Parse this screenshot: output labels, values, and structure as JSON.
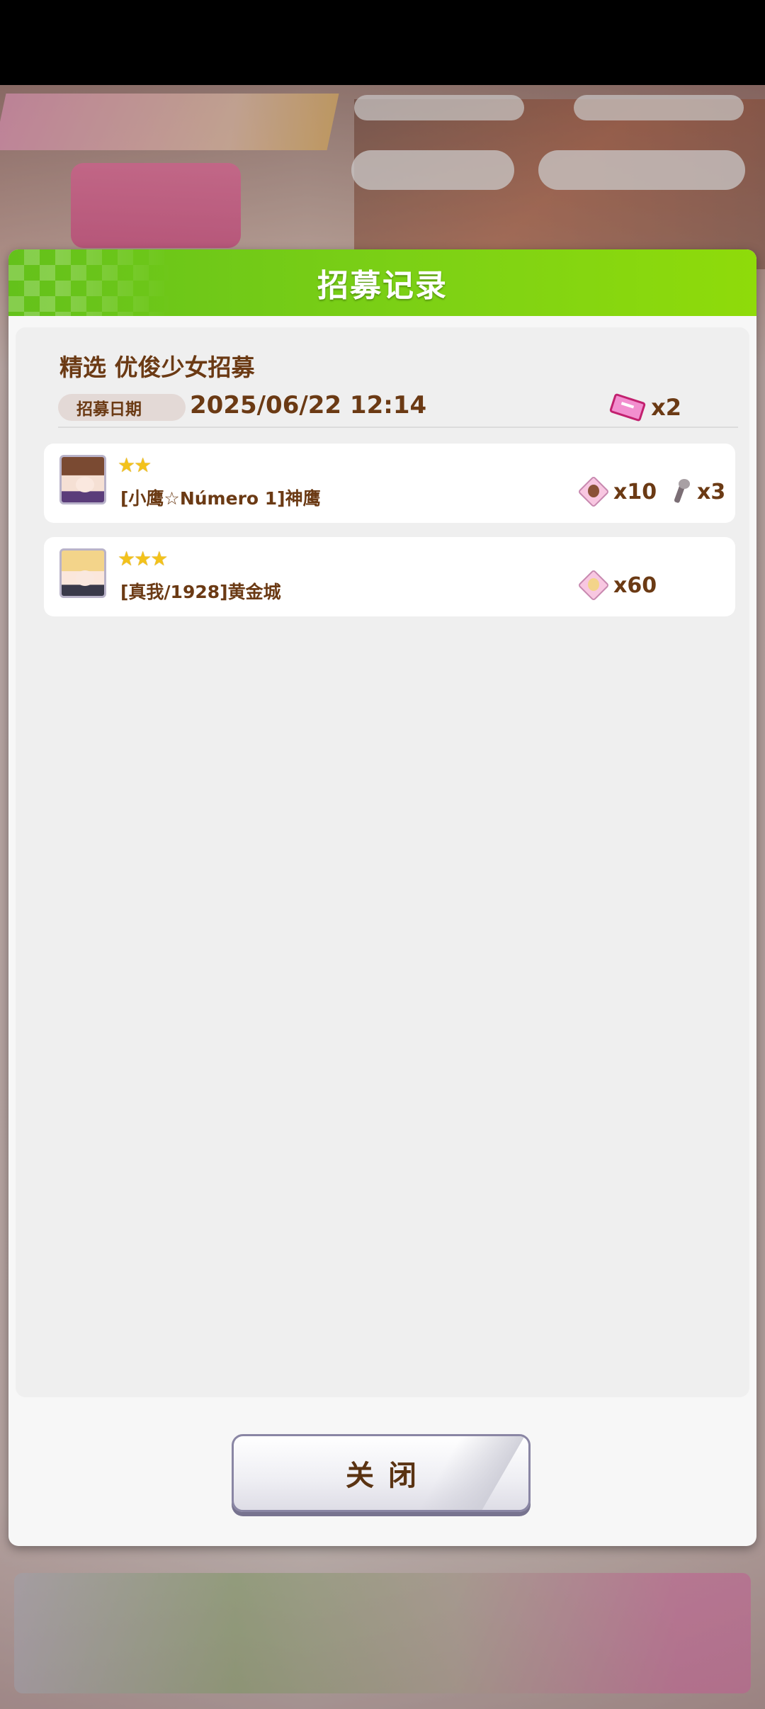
{
  "dialog": {
    "title": "招募记录",
    "banner_name": "精选  优俊少女招募",
    "date_label": "招募日期",
    "date_value": "2025/06/22  12:14",
    "ticket_count": "x2",
    "close_label": "关闭"
  },
  "records": [
    {
      "stars": "★★",
      "star_count": 2,
      "name": "[小鹰☆Número  1]神鹰",
      "rewards": [
        {
          "icon": "character-piece-icon",
          "count": "x10"
        },
        {
          "icon": "bone-item-icon",
          "count": "x3"
        }
      ]
    },
    {
      "stars": "★★★",
      "star_count": 3,
      "name": "[真我/1928]黄金城",
      "rewards": [
        {
          "icon": "character-piece-icon",
          "count": "x60"
        }
      ]
    }
  ],
  "colors": {
    "header_green": "#7fd214",
    "text_brown": "#6b3a14",
    "star_gold": "#f3c21b",
    "ticket_pink": "#f28fcf"
  }
}
